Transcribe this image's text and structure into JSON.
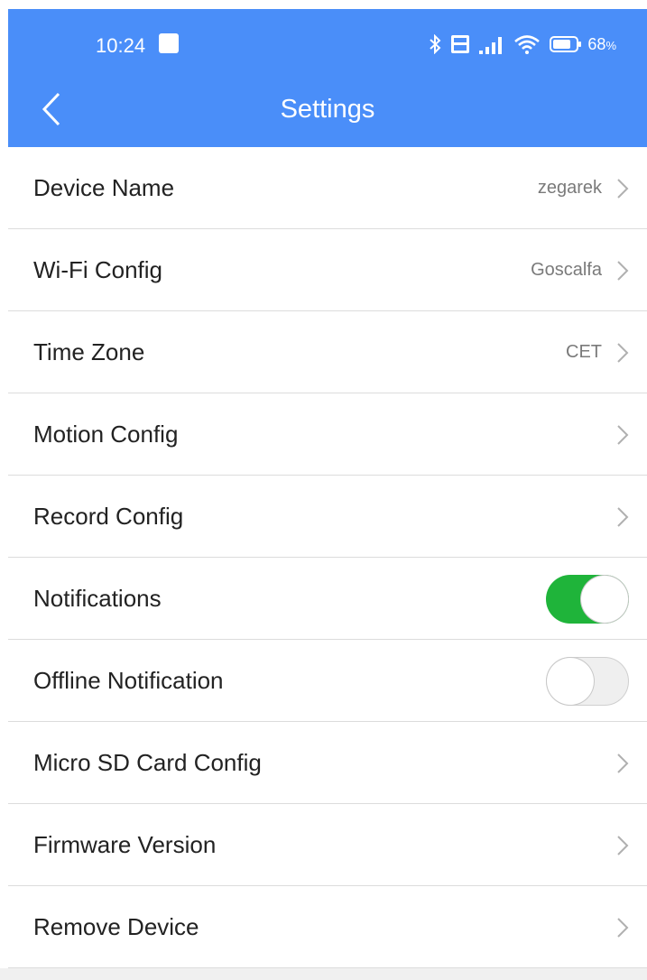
{
  "statusbar": {
    "time": "10:24",
    "battery_percent": "68",
    "battery_unit": "%",
    "icons": [
      "bluetooth-icon",
      "volte-icon",
      "signal-icon",
      "wifi-icon",
      "battery-icon"
    ]
  },
  "header": {
    "title": "Settings",
    "back_icon": "chevron-left-icon",
    "background_color": "#4a8ef9"
  },
  "settings": {
    "device_name": {
      "label": "Device Name",
      "value": "zegarek"
    },
    "wifi_config": {
      "label": "Wi-Fi Config",
      "value": "Goscalfa"
    },
    "time_zone": {
      "label": "Time Zone",
      "value": "CET"
    },
    "motion_config": {
      "label": "Motion Config"
    },
    "record_config": {
      "label": "Record Config"
    },
    "notifications": {
      "label": "Notifications",
      "enabled": true
    },
    "offline_notification": {
      "label": "Offline Notification",
      "enabled": false
    },
    "sd_card_config": {
      "label": "Micro SD Card Config"
    },
    "firmware_version": {
      "label": "Firmware Version"
    },
    "remove_device": {
      "label": "Remove Device"
    }
  },
  "colors": {
    "toggle_on": "#1fb43a",
    "toggle_off": "#efefef",
    "chevron": "#b0b0b0"
  }
}
